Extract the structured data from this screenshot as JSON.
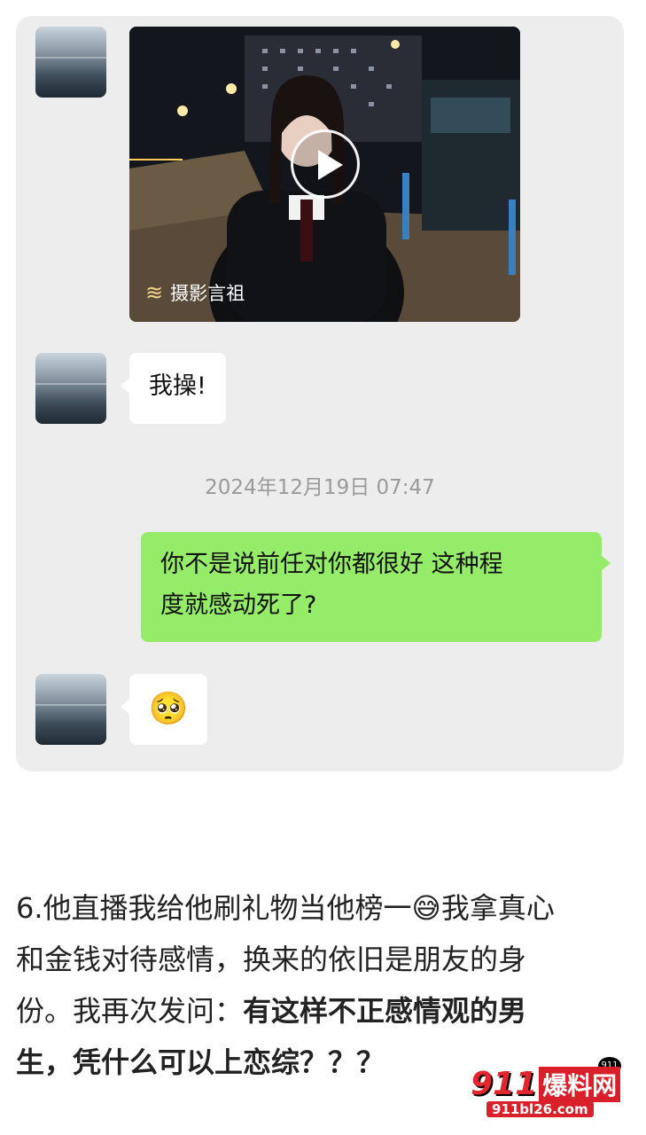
{
  "chat": {
    "video": {
      "channel_icon": "wave-logo-icon",
      "channel_name": "摄影言祖"
    },
    "messages": [
      {
        "side": "left",
        "text": "我操!"
      },
      {
        "side": "right",
        "text_line1": "你不是说前任对你都很好 这种程",
        "text_line2": "度就感动死了?"
      },
      {
        "side": "left",
        "emoji": "pleading-face-emoji",
        "emoji_char": "🥺"
      }
    ],
    "timestamp": "2024年12月19日 07:47"
  },
  "article": {
    "line1_prefix": "6.他直播我给他刷礼物当他榜一",
    "line1_emoji": "😅",
    "line1_suffix": "我拿真心",
    "line2": "和金钱对待感情，换来的依旧是朋友的身",
    "line3_normal": "份。我再次发问：",
    "line3_bold": "有这样不正感情观的男",
    "line4_bold": "生，凭什么可以上恋综？？？"
  },
  "watermark": {
    "number": "911",
    "name": "爆料网",
    "badge": "911",
    "url": "911bl26.com"
  },
  "colors": {
    "panel_bg": "#ededed",
    "own_bubble": "#95ec69",
    "other_bubble": "#ffffff",
    "timestamp": "#9a9a9a",
    "watermark_red": "#d9202a"
  }
}
